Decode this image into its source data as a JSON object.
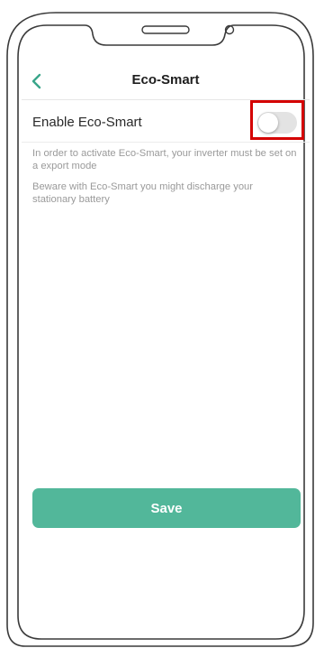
{
  "header": {
    "title": "Eco-Smart",
    "back_icon": "chevron-left-icon"
  },
  "setting": {
    "label": "Enable Eco-Smart",
    "enabled": false
  },
  "notes": [
    "In order to activate Eco-Smart, your inverter must be set on a export mode",
    "Beware with Eco-Smart you might discharge your stationary battery"
  ],
  "save_label": "Save",
  "colors": {
    "accent": "#52b79a",
    "back_arrow": "#3aa58a",
    "highlight": "#d40000"
  }
}
